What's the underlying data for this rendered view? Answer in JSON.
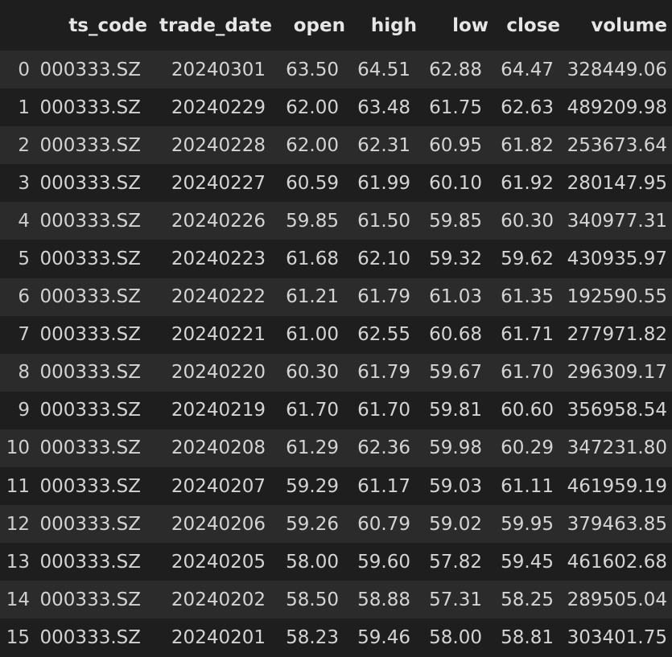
{
  "table": {
    "index_header": "",
    "columns": [
      "ts_code",
      "trade_date",
      "open",
      "high",
      "low",
      "close",
      "volume"
    ],
    "rows": [
      {
        "index": "0",
        "cells": [
          "000333.SZ",
          "20240301",
          "63.50",
          "64.51",
          "62.88",
          "64.47",
          "328449.06"
        ]
      },
      {
        "index": "1",
        "cells": [
          "000333.SZ",
          "20240229",
          "62.00",
          "63.48",
          "61.75",
          "62.63",
          "489209.98"
        ]
      },
      {
        "index": "2",
        "cells": [
          "000333.SZ",
          "20240228",
          "62.00",
          "62.31",
          "60.95",
          "61.82",
          "253673.64"
        ]
      },
      {
        "index": "3",
        "cells": [
          "000333.SZ",
          "20240227",
          "60.59",
          "61.99",
          "60.10",
          "61.92",
          "280147.95"
        ]
      },
      {
        "index": "4",
        "cells": [
          "000333.SZ",
          "20240226",
          "59.85",
          "61.50",
          "59.85",
          "60.30",
          "340977.31"
        ]
      },
      {
        "index": "5",
        "cells": [
          "000333.SZ",
          "20240223",
          "61.68",
          "62.10",
          "59.32",
          "59.62",
          "430935.97"
        ]
      },
      {
        "index": "6",
        "cells": [
          "000333.SZ",
          "20240222",
          "61.21",
          "61.79",
          "61.03",
          "61.35",
          "192590.55"
        ]
      },
      {
        "index": "7",
        "cells": [
          "000333.SZ",
          "20240221",
          "61.00",
          "62.55",
          "60.68",
          "61.71",
          "277971.82"
        ]
      },
      {
        "index": "8",
        "cells": [
          "000333.SZ",
          "20240220",
          "60.30",
          "61.79",
          "59.67",
          "61.70",
          "296309.17"
        ]
      },
      {
        "index": "9",
        "cells": [
          "000333.SZ",
          "20240219",
          "61.70",
          "61.70",
          "59.81",
          "60.60",
          "356958.54"
        ]
      },
      {
        "index": "10",
        "cells": [
          "000333.SZ",
          "20240208",
          "61.29",
          "62.36",
          "59.98",
          "60.29",
          "347231.80"
        ]
      },
      {
        "index": "11",
        "cells": [
          "000333.SZ",
          "20240207",
          "59.29",
          "61.17",
          "59.03",
          "61.11",
          "461959.19"
        ]
      },
      {
        "index": "12",
        "cells": [
          "000333.SZ",
          "20240206",
          "59.26",
          "60.79",
          "59.02",
          "59.95",
          "379463.85"
        ]
      },
      {
        "index": "13",
        "cells": [
          "000333.SZ",
          "20240205",
          "58.00",
          "59.60",
          "57.82",
          "59.45",
          "461602.68"
        ]
      },
      {
        "index": "14",
        "cells": [
          "000333.SZ",
          "20240202",
          "58.50",
          "58.88",
          "57.31",
          "58.25",
          "289505.04"
        ]
      },
      {
        "index": "15",
        "cells": [
          "000333.SZ",
          "20240201",
          "58.23",
          "59.46",
          "58.00",
          "58.81",
          "303401.75"
        ]
      }
    ]
  },
  "colors": {
    "background": "#1e1e1e",
    "row_stripe": "#2b2b2b",
    "text": "#d4d4d4"
  }
}
